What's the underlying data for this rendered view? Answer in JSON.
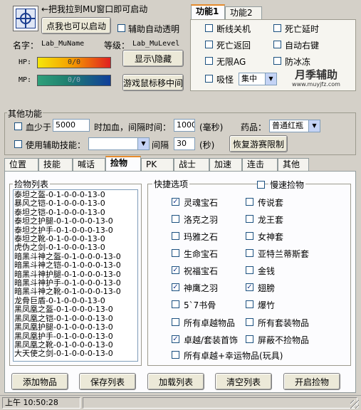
{
  "top": {
    "drag_hint": "←把我拉到MU窗口即可启动",
    "click_start_button": "点我也可以启动",
    "auto_transparent_label": "辅助自动透明",
    "name_label": "名字：",
    "name_value": "Lab_MuName",
    "level_label": "等级：",
    "level_value": "Lab_MuLevel",
    "hp_label": "HP:",
    "hp_value": "0/0",
    "mp_label": "MP:",
    "mp_value": "0/0",
    "show_hide_button": "显示\\隐藏",
    "mouse_center_button": "游戏鼠标移中间"
  },
  "func_tabs": [
    "功能1",
    "功能2"
  ],
  "func_panel": {
    "disconnect_shutdown": "断线关机",
    "death_delay": "死亡延时",
    "death_return": "死亡返回",
    "auto_right_key": "自动右键",
    "no_ag": "无限AG",
    "anti_freeze": "防冰冻",
    "absorb_monster": "吸怪",
    "absorb_mode": "集中",
    "logo_text": "月季辅助",
    "logo_url": "www.muyjfz.com"
  },
  "other": {
    "title": "其他功能",
    "hp_less_label": "血少于",
    "hp_less_value": "5000",
    "add_hp_label": "时加血，间隔时间：",
    "interval_value": "1000",
    "ms_label": "(毫秒)",
    "drug_label": "药品：",
    "drug_value": "普通红瓶",
    "use_skill_label": "使用辅助技能：",
    "skill_value": "",
    "interval_label": "间隔",
    "seconds_value": "30",
    "seconds_label": "(秒)",
    "restore_button": "恢复游赛限制"
  },
  "main_tabs": [
    "位置",
    "技能",
    "喊话",
    "捡物",
    "PK",
    "战士",
    "加速",
    "连击",
    "其他"
  ],
  "pick": {
    "list_title": "捡物列表",
    "items": [
      "泰坦之盔-0-1-0-0-0-13-0",
      "暴风之铠-0-1-0-0-0-13-0",
      "泰坦之铠-0-1-0-0-0-13-0",
      "泰坦之护腿-0-1-0-0-0-13-0",
      "泰坦之护手-0-1-0-0-0-13-0",
      "泰坦之靴-0-1-0-0-0-13-0",
      "虎伪之剑-0-1-0-0-0-13-0",
      "暗黑斗神之盔-0-1-0-0-0-13-0",
      "暗黑斗神之铠-0-1-0-0-0-13-0",
      "暗黑斗神护腿-0-1-0-0-0-13-0",
      "暗黑斗神护手-0-1-0-0-0-13-0",
      "暗黑斗神之靴-0-1-0-0-0-13-0",
      "龙骨巨盾-0-1-0-0-0-13-0",
      "黑凤凰之盔-0-1-0-0-0-13-0",
      "黑凤凰之铠-0-1-0-0-0-13-0",
      "黑凤凰护腿-0-1-0-0-0-13-0",
      "黑凤凰护手-0-1-0-0-0-13-0",
      "黑凤凰之靴-0-1-0-0-0-13-0",
      "大天使之剑-0-1-0-0-0-13-0"
    ],
    "quick_title": "快捷选项",
    "slow_pick": "慢速捡物",
    "opts_left": [
      {
        "label": "灵魂宝石",
        "checked": true
      },
      {
        "label": "洛克之羽",
        "checked": false
      },
      {
        "label": "玛雅之石",
        "checked": false
      },
      {
        "label": "生命宝石",
        "checked": false
      },
      {
        "label": "祝福宝石",
        "checked": true
      },
      {
        "label": "神鹰之羽",
        "checked": true
      },
      {
        "label": "5`7书骨",
        "checked": false
      }
    ],
    "opts_right": [
      {
        "label": "传说套",
        "checked": false
      },
      {
        "label": "龙王套",
        "checked": false
      },
      {
        "label": "女神套",
        "checked": false
      },
      {
        "label": "亚特兰蒂斯套",
        "checked": false
      },
      {
        "label": "金钱",
        "checked": false
      },
      {
        "label": "翅膀",
        "checked": true
      },
      {
        "label": "爆竹",
        "checked": false
      }
    ],
    "all_excellent": "所有卓越物品",
    "all_set": "所有套装物品",
    "excellent_set_jewel": "卓越/套装首饰",
    "block_no_pick": "屏蔽不捡物品",
    "all_excellent_luck": "所有卓越+幸运物品(玩具)",
    "check_mark": "✓"
  },
  "bottom_buttons": [
    "添加物品",
    "保存列表",
    "加载列表",
    "清空列表",
    "开启捡物"
  ],
  "status": {
    "time": "上午 10:50:28"
  }
}
